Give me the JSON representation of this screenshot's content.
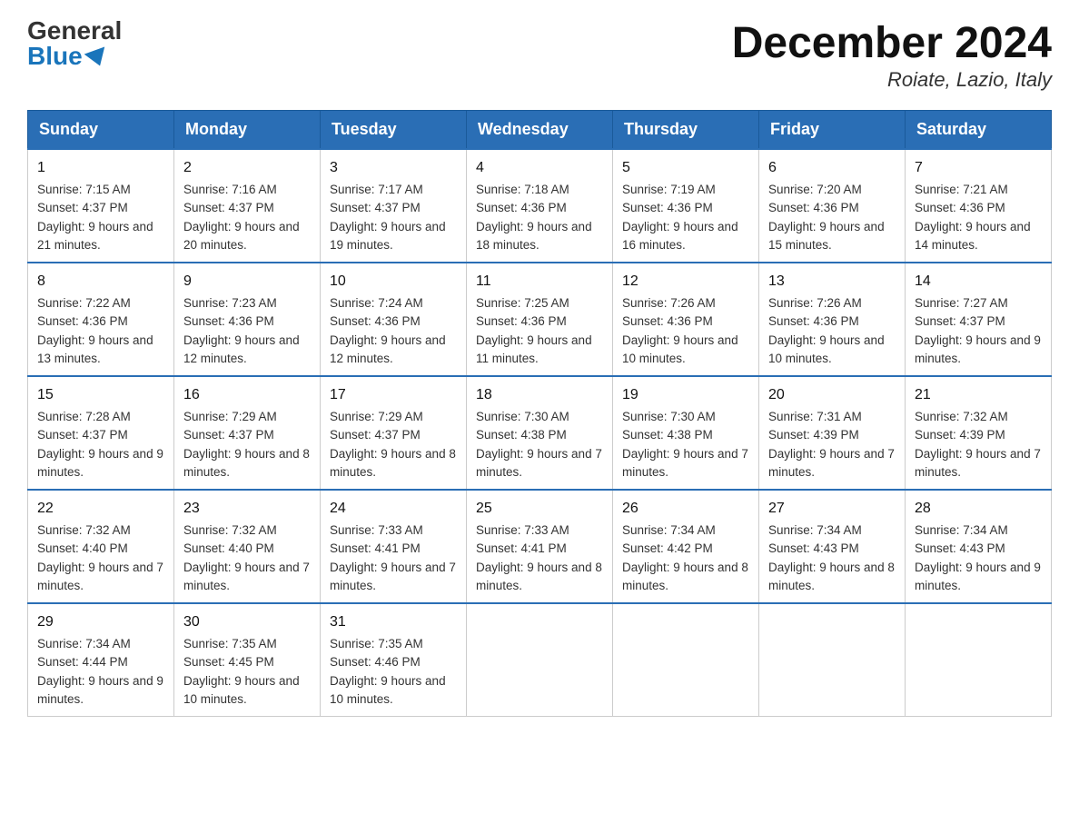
{
  "header": {
    "logo_general": "General",
    "logo_blue": "Blue",
    "month_title": "December 2024",
    "location": "Roiate, Lazio, Italy"
  },
  "days_of_week": [
    "Sunday",
    "Monday",
    "Tuesday",
    "Wednesday",
    "Thursday",
    "Friday",
    "Saturday"
  ],
  "weeks": [
    [
      {
        "day": "1",
        "sunrise": "Sunrise: 7:15 AM",
        "sunset": "Sunset: 4:37 PM",
        "daylight": "Daylight: 9 hours and 21 minutes."
      },
      {
        "day": "2",
        "sunrise": "Sunrise: 7:16 AM",
        "sunset": "Sunset: 4:37 PM",
        "daylight": "Daylight: 9 hours and 20 minutes."
      },
      {
        "day": "3",
        "sunrise": "Sunrise: 7:17 AM",
        "sunset": "Sunset: 4:37 PM",
        "daylight": "Daylight: 9 hours and 19 minutes."
      },
      {
        "day": "4",
        "sunrise": "Sunrise: 7:18 AM",
        "sunset": "Sunset: 4:36 PM",
        "daylight": "Daylight: 9 hours and 18 minutes."
      },
      {
        "day": "5",
        "sunrise": "Sunrise: 7:19 AM",
        "sunset": "Sunset: 4:36 PM",
        "daylight": "Daylight: 9 hours and 16 minutes."
      },
      {
        "day": "6",
        "sunrise": "Sunrise: 7:20 AM",
        "sunset": "Sunset: 4:36 PM",
        "daylight": "Daylight: 9 hours and 15 minutes."
      },
      {
        "day": "7",
        "sunrise": "Sunrise: 7:21 AM",
        "sunset": "Sunset: 4:36 PM",
        "daylight": "Daylight: 9 hours and 14 minutes."
      }
    ],
    [
      {
        "day": "8",
        "sunrise": "Sunrise: 7:22 AM",
        "sunset": "Sunset: 4:36 PM",
        "daylight": "Daylight: 9 hours and 13 minutes."
      },
      {
        "day": "9",
        "sunrise": "Sunrise: 7:23 AM",
        "sunset": "Sunset: 4:36 PM",
        "daylight": "Daylight: 9 hours and 12 minutes."
      },
      {
        "day": "10",
        "sunrise": "Sunrise: 7:24 AM",
        "sunset": "Sunset: 4:36 PM",
        "daylight": "Daylight: 9 hours and 12 minutes."
      },
      {
        "day": "11",
        "sunrise": "Sunrise: 7:25 AM",
        "sunset": "Sunset: 4:36 PM",
        "daylight": "Daylight: 9 hours and 11 minutes."
      },
      {
        "day": "12",
        "sunrise": "Sunrise: 7:26 AM",
        "sunset": "Sunset: 4:36 PM",
        "daylight": "Daylight: 9 hours and 10 minutes."
      },
      {
        "day": "13",
        "sunrise": "Sunrise: 7:26 AM",
        "sunset": "Sunset: 4:36 PM",
        "daylight": "Daylight: 9 hours and 10 minutes."
      },
      {
        "day": "14",
        "sunrise": "Sunrise: 7:27 AM",
        "sunset": "Sunset: 4:37 PM",
        "daylight": "Daylight: 9 hours and 9 minutes."
      }
    ],
    [
      {
        "day": "15",
        "sunrise": "Sunrise: 7:28 AM",
        "sunset": "Sunset: 4:37 PM",
        "daylight": "Daylight: 9 hours and 9 minutes."
      },
      {
        "day": "16",
        "sunrise": "Sunrise: 7:29 AM",
        "sunset": "Sunset: 4:37 PM",
        "daylight": "Daylight: 9 hours and 8 minutes."
      },
      {
        "day": "17",
        "sunrise": "Sunrise: 7:29 AM",
        "sunset": "Sunset: 4:37 PM",
        "daylight": "Daylight: 9 hours and 8 minutes."
      },
      {
        "day": "18",
        "sunrise": "Sunrise: 7:30 AM",
        "sunset": "Sunset: 4:38 PM",
        "daylight": "Daylight: 9 hours and 7 minutes."
      },
      {
        "day": "19",
        "sunrise": "Sunrise: 7:30 AM",
        "sunset": "Sunset: 4:38 PM",
        "daylight": "Daylight: 9 hours and 7 minutes."
      },
      {
        "day": "20",
        "sunrise": "Sunrise: 7:31 AM",
        "sunset": "Sunset: 4:39 PM",
        "daylight": "Daylight: 9 hours and 7 minutes."
      },
      {
        "day": "21",
        "sunrise": "Sunrise: 7:32 AM",
        "sunset": "Sunset: 4:39 PM",
        "daylight": "Daylight: 9 hours and 7 minutes."
      }
    ],
    [
      {
        "day": "22",
        "sunrise": "Sunrise: 7:32 AM",
        "sunset": "Sunset: 4:40 PM",
        "daylight": "Daylight: 9 hours and 7 minutes."
      },
      {
        "day": "23",
        "sunrise": "Sunrise: 7:32 AM",
        "sunset": "Sunset: 4:40 PM",
        "daylight": "Daylight: 9 hours and 7 minutes."
      },
      {
        "day": "24",
        "sunrise": "Sunrise: 7:33 AM",
        "sunset": "Sunset: 4:41 PM",
        "daylight": "Daylight: 9 hours and 7 minutes."
      },
      {
        "day": "25",
        "sunrise": "Sunrise: 7:33 AM",
        "sunset": "Sunset: 4:41 PM",
        "daylight": "Daylight: 9 hours and 8 minutes."
      },
      {
        "day": "26",
        "sunrise": "Sunrise: 7:34 AM",
        "sunset": "Sunset: 4:42 PM",
        "daylight": "Daylight: 9 hours and 8 minutes."
      },
      {
        "day": "27",
        "sunrise": "Sunrise: 7:34 AM",
        "sunset": "Sunset: 4:43 PM",
        "daylight": "Daylight: 9 hours and 8 minutes."
      },
      {
        "day": "28",
        "sunrise": "Sunrise: 7:34 AM",
        "sunset": "Sunset: 4:43 PM",
        "daylight": "Daylight: 9 hours and 9 minutes."
      }
    ],
    [
      {
        "day": "29",
        "sunrise": "Sunrise: 7:34 AM",
        "sunset": "Sunset: 4:44 PM",
        "daylight": "Daylight: 9 hours and 9 minutes."
      },
      {
        "day": "30",
        "sunrise": "Sunrise: 7:35 AM",
        "sunset": "Sunset: 4:45 PM",
        "daylight": "Daylight: 9 hours and 10 minutes."
      },
      {
        "day": "31",
        "sunrise": "Sunrise: 7:35 AM",
        "sunset": "Sunset: 4:46 PM",
        "daylight": "Daylight: 9 hours and 10 minutes."
      },
      null,
      null,
      null,
      null
    ]
  ]
}
